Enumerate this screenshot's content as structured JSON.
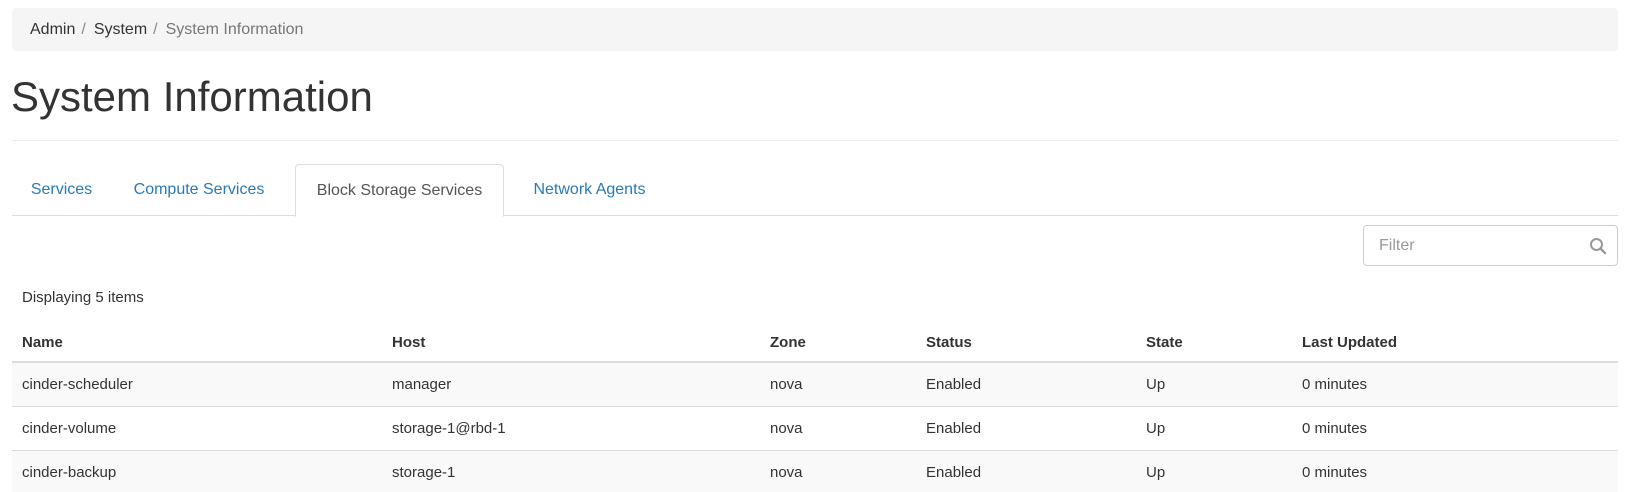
{
  "breadcrumb": {
    "items": [
      "Admin",
      "System",
      "System Information"
    ],
    "separator": "/"
  },
  "page_title": "System Information",
  "tabs": [
    {
      "label": "Services",
      "active": false
    },
    {
      "label": "Compute Services",
      "active": false
    },
    {
      "label": "Block Storage Services",
      "active": true
    },
    {
      "label": "Network Agents",
      "active": false
    }
  ],
  "filter": {
    "placeholder": "Filter",
    "value": "",
    "icon": "search-icon"
  },
  "count_text": "Displaying 5 items",
  "table": {
    "columns": [
      "Name",
      "Host",
      "Zone",
      "Status",
      "State",
      "Last Updated"
    ],
    "rows": [
      [
        "cinder-scheduler",
        "manager",
        "nova",
        "Enabled",
        "Up",
        "0 minutes"
      ],
      [
        "cinder-volume",
        "storage-1@rbd-1",
        "nova",
        "Enabled",
        "Up",
        "0 minutes"
      ],
      [
        "cinder-backup",
        "storage-1",
        "nova",
        "Enabled",
        "Up",
        "0 minutes"
      ]
    ]
  },
  "colors": {
    "link": "#2a7ab8",
    "breadcrumb_bg": "#f5f5f5",
    "stripe": "#f9f9f9",
    "border": "#dddddd"
  }
}
